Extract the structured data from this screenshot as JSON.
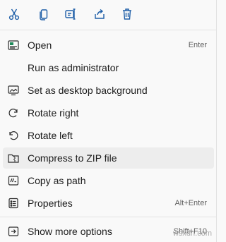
{
  "toolbar": {
    "items": [
      {
        "icon": "cut-icon",
        "label": "Cut"
      },
      {
        "icon": "copy-icon",
        "label": "Copy"
      },
      {
        "icon": "rename-icon",
        "label": "Rename"
      },
      {
        "icon": "share-icon",
        "label": "Share"
      },
      {
        "icon": "delete-icon",
        "label": "Delete"
      }
    ],
    "accent_color": "#1f5fa8"
  },
  "menu": {
    "items": [
      {
        "label": "Open",
        "shortcut": "Enter",
        "icon": "open-app-icon"
      },
      {
        "label": "Run as administrator",
        "shortcut": "",
        "icon": ""
      },
      {
        "label": "Set as desktop background",
        "shortcut": "",
        "icon": "desktop-background-icon"
      },
      {
        "label": "Rotate right",
        "shortcut": "",
        "icon": "rotate-right-icon"
      },
      {
        "label": "Rotate left",
        "shortcut": "",
        "icon": "rotate-left-icon"
      },
      {
        "label": "Compress to ZIP file",
        "shortcut": "",
        "icon": "zip-folder-icon"
      },
      {
        "label": "Copy as path",
        "shortcut": "",
        "icon": "copy-path-icon"
      },
      {
        "label": "Properties",
        "shortcut": "Alt+Enter",
        "icon": "properties-icon"
      }
    ],
    "more": {
      "label": "Show more options",
      "shortcut": "Shift+F10",
      "icon": "more-options-icon"
    }
  },
  "watermark": "wsxdn.com"
}
